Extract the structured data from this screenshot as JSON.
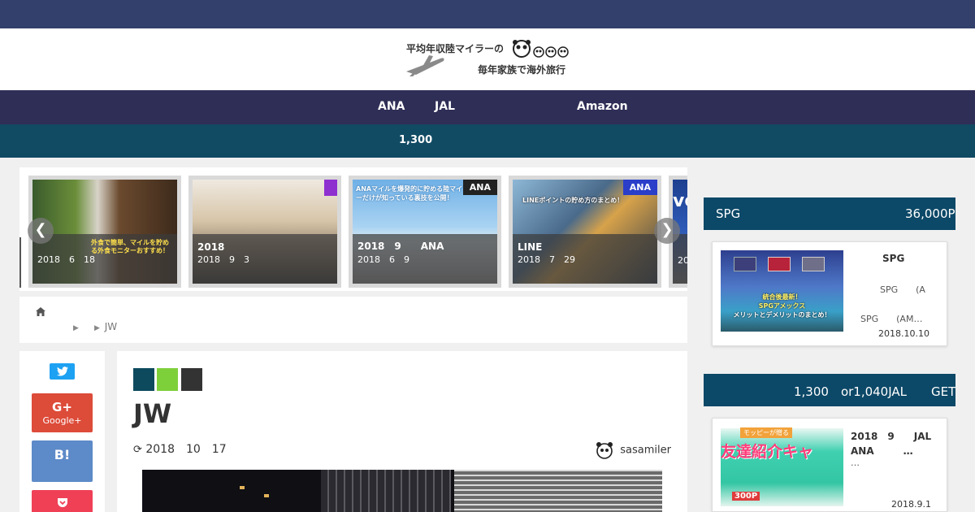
{
  "header": {
    "tagline": "平均年収陸マイラーの",
    "subtitle": "毎年家族で海外旅行"
  },
  "nav": {
    "items": [
      "ANA",
      "JAL",
      "Amazon"
    ]
  },
  "promo": {
    "text": "1,300"
  },
  "slider": {
    "cards": [
      {
        "title": "",
        "date": "2018　6　18",
        "tag": "",
        "image_text": "外食で簡単、マイルを貯める外食モニターおすすめ！"
      },
      {
        "title": "2018",
        "date": "2018　9　3",
        "tag": "",
        "image_text": ""
      },
      {
        "title": "2018　9　　ANA",
        "date": "2018　6　9",
        "tag": "ANA",
        "image_text": "ANAマイルを爆発的に貯める陸マイラーだけが知っている裏技を公開！"
      },
      {
        "title": "LINE",
        "date": "2018　7　29",
        "tag": "ANA",
        "image_text": "LINEポイントの貯め方のまとめ！"
      },
      {
        "title": "",
        "date": "20",
        "tag": "",
        "image_text": "ve"
      }
    ]
  },
  "breadcrumb": {
    "home_icon": "home-icon",
    "current": "JW"
  },
  "share": {
    "twitter_icon": "twitter-icon",
    "google_label": "Google+",
    "google_mark": "G+",
    "hatena_label": "B!",
    "pocket_icon": "pocket-icon"
  },
  "article": {
    "title": "JW",
    "updated": "2018　10　17",
    "author": "sasamiler",
    "category_colors": [
      "#0d4a5e",
      "#7ed03b",
      "#333333"
    ]
  },
  "sidebar": {
    "widget1": {
      "title_left": "SPG",
      "title_right": "36,000P",
      "post_title": "SPG",
      "post_line2": "SPG　　(A",
      "post_line3": "SPG　　(AM…",
      "date": "2018.10.10",
      "image_text1": "統合後最新！",
      "image_text2": "SPGアメックス",
      "image_text3": "メリットとデメリットのまとめ！"
    },
    "widget2": {
      "title": "1,300　or1,040JAL　　GET",
      "post_title_line1": "2018　9　　JAL",
      "post_title_line2": "ANA　　　…",
      "post_line3": "…",
      "date": "2018.9.1",
      "image_text1": "モッピーが贈る",
      "image_text2": "友達紹介キャ",
      "image_text3": "300P"
    }
  }
}
